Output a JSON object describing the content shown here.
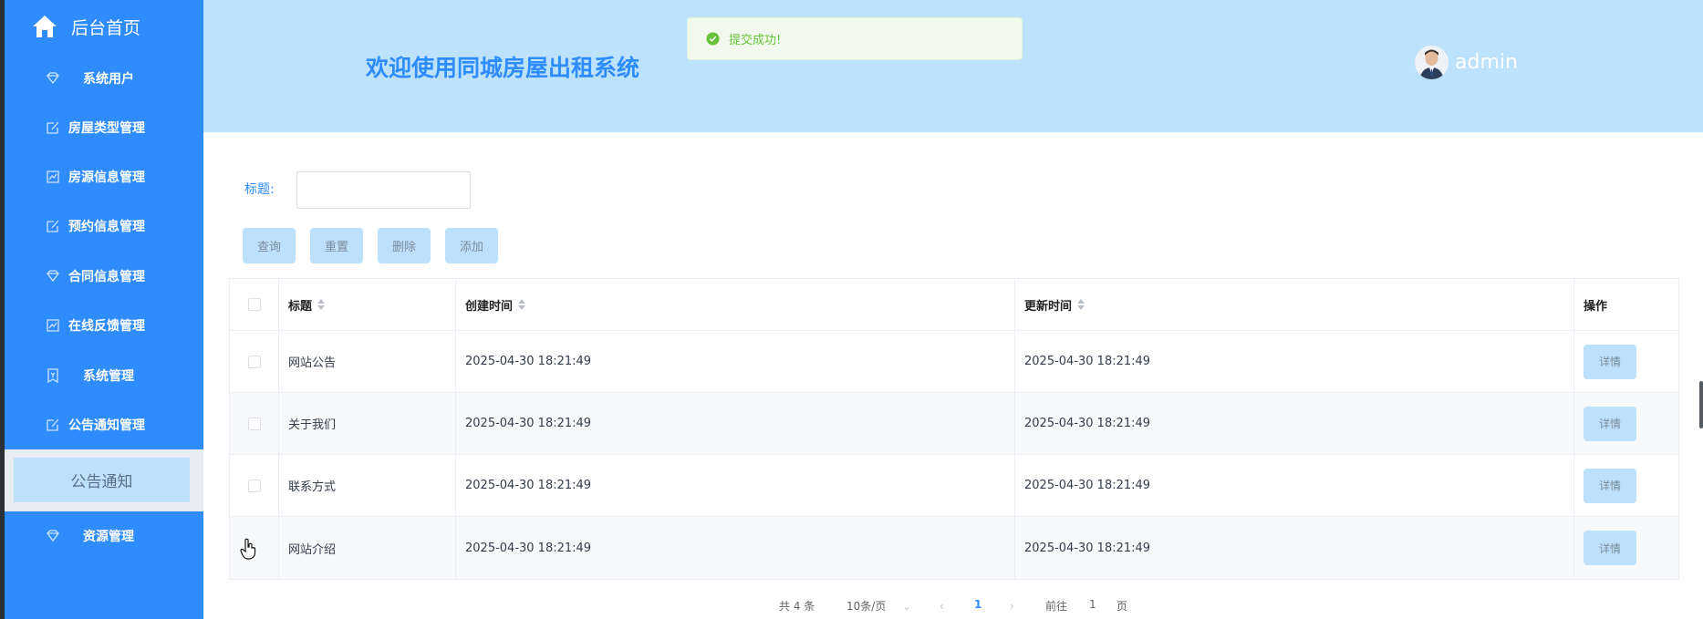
{
  "sidebar": {
    "home_label": "后台首页",
    "items": [
      {
        "label": "系统用户",
        "icon": "diamond-icon"
      },
      {
        "label": "房屋类型管理",
        "icon": "edit-icon"
      },
      {
        "label": "房源信息管理",
        "icon": "chart-icon"
      },
      {
        "label": "预约信息管理",
        "icon": "edit-icon"
      },
      {
        "label": "合同信息管理",
        "icon": "diamond-icon"
      },
      {
        "label": "在线反馈管理",
        "icon": "chart-icon"
      },
      {
        "label": "系统管理",
        "icon": "ticket-icon"
      },
      {
        "label": "公告通知管理",
        "icon": "edit-icon"
      },
      {
        "label": "资源管理",
        "icon": "diamond-icon"
      }
    ],
    "sub_item": "公告通知"
  },
  "header": {
    "title": "欢迎使用同城房屋出租系统",
    "username": "admin"
  },
  "toast": {
    "message": "提交成功!"
  },
  "search": {
    "label": "标题:",
    "value": "",
    "placeholder": ""
  },
  "buttons": {
    "query": "查询",
    "reset": "重置",
    "delete": "删除",
    "add": "添加"
  },
  "table": {
    "columns": [
      "标题",
      "创建时间",
      "更新时间",
      "操作"
    ],
    "rows": [
      {
        "title": "网站公告",
        "created": "2025-04-30 18:21:49",
        "updated": "2025-04-30 18:21:49",
        "action": "详情"
      },
      {
        "title": "关于我们",
        "created": "2025-04-30 18:21:49",
        "updated": "2025-04-30 18:21:49",
        "action": "详情"
      },
      {
        "title": "联系方式",
        "created": "2025-04-30 18:21:49",
        "updated": "2025-04-30 18:21:49",
        "action": "详情"
      },
      {
        "title": "网站介绍",
        "created": "2025-04-30 18:21:49",
        "updated": "2025-04-30 18:21:49",
        "action": "详情"
      }
    ]
  },
  "pagination": {
    "total": "共 4 条",
    "page_size": "10条/页",
    "current_page": "1",
    "goto_prefix": "前往",
    "goto_value": "1",
    "goto_suffix": "页"
  },
  "colors": {
    "sidebar_bg": "#2e8cff",
    "header_bg": "#bde2fd",
    "accent": "#2d8cff",
    "button_bg": "#bde0fd",
    "toast_text": "#67c23a"
  }
}
